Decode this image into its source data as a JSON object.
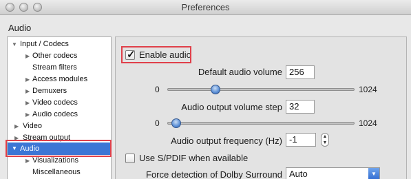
{
  "window": {
    "title": "Preferences"
  },
  "section_title": "Audio",
  "sidebar": {
    "items": [
      {
        "label": "Input / Codecs",
        "expanded": true,
        "level": 0
      },
      {
        "label": "Other codecs",
        "expanded": false,
        "level": 1
      },
      {
        "label": "Stream filters",
        "level": 1
      },
      {
        "label": "Access modules",
        "expanded": false,
        "level": 1
      },
      {
        "label": "Demuxers",
        "expanded": false,
        "level": 1
      },
      {
        "label": "Video codecs",
        "expanded": false,
        "level": 1
      },
      {
        "label": "Audio codecs",
        "expanded": false,
        "level": 1
      },
      {
        "label": "Video",
        "expanded": false,
        "level": 0
      },
      {
        "label": "Stream output",
        "expanded": false,
        "level": 0
      },
      {
        "label": "Audio",
        "expanded": true,
        "level": 0,
        "selected": true
      },
      {
        "label": "Visualizations",
        "expanded": false,
        "level": 1
      },
      {
        "label": "Miscellaneous",
        "level": 1
      }
    ]
  },
  "audio": {
    "enable_audio": {
      "label": "Enable audio",
      "checked": true
    },
    "default_volume": {
      "label": "Default audio volume",
      "value": "256"
    },
    "volume_slider": {
      "min": "0",
      "max": "1024",
      "value_fraction": 0.25
    },
    "volume_step": {
      "label": "Audio output volume step",
      "value": "32"
    },
    "step_slider": {
      "min": "0",
      "max": "1024",
      "value_fraction": 0.03
    },
    "frequency": {
      "label": "Audio output frequency (Hz)",
      "value": "-1"
    },
    "spdif": {
      "label": "Use S/PDIF when available",
      "checked": false
    },
    "dolby": {
      "label": "Force detection of Dolby Surround",
      "value": "Auto"
    }
  },
  "colors": {
    "selection": "#3c76d5",
    "highlight_box": "#e0404a",
    "slider_knob": "#5b8fd6"
  },
  "icons": [
    "checkmark-icon",
    "triangle-right-icon",
    "triangle-down-icon",
    "stepper-icon",
    "chevron-down-icon"
  ]
}
